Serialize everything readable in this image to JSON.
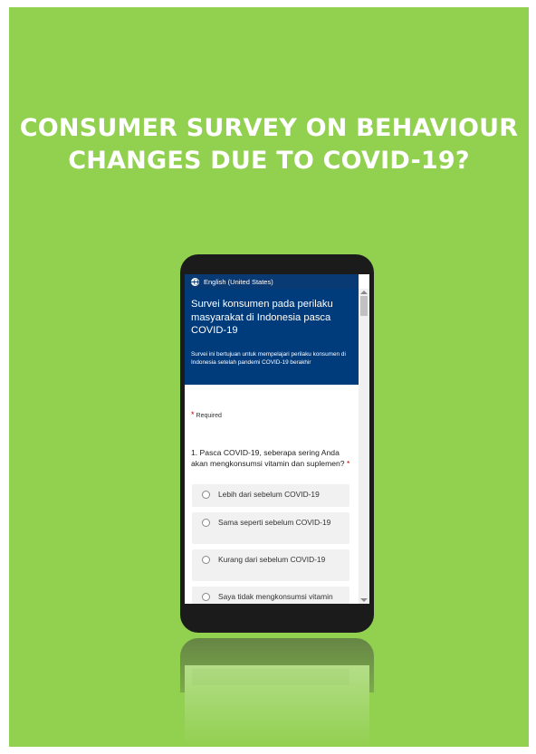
{
  "headline": {
    "line1": "CONSUMER SURVEY ON BEHAVIOUR",
    "line2": "CHANGES DUE TO COVID-19?"
  },
  "phone": {
    "language": "English (United States)",
    "form": {
      "title": "Survei konsumen pada perilaku masyarakat di Indonesia pasca COVID-19",
      "description": "Survei ini bertujuan untuk mempelajari perilaku konsumen di Indonesia setelah pandemi COVID-19 berakhir",
      "required_note": "Required",
      "question": "1. Pasca COVID-19, seberapa sering Anda akan mengkonsumsi vitamin dan suplemen?",
      "required_mark": "*",
      "options": [
        "Lebih dari sebelum COVID-19",
        "Sama seperti sebelum COVID-19",
        "Kurang dari sebelum COVID-19",
        "Saya tidak mengkonsumsi vitamin dan suplemen"
      ]
    }
  },
  "colors": {
    "background": "#92d050",
    "header_blue": "#003b7c",
    "required_red": "#c00000"
  },
  "icons": [
    "globe-icon",
    "radio-icon",
    "scroll-up-icon",
    "scroll-down-icon"
  ]
}
